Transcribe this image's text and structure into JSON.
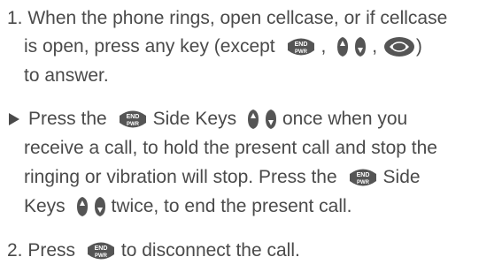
{
  "step1": {
    "number": "1.",
    "line1": "When the phone rings, open cellcase, or if cellcase",
    "line2_text": "is open, press any key (except",
    "line2_comma1": ",",
    "line2_comma2": ",",
    "line2_close": ")",
    "line3": "to answer."
  },
  "note": {
    "line1_a": "Press the",
    "line1_b": "Side Keys",
    "line1_c": "once when you",
    "line2": "receive a call, to hold the present call and stop the",
    "line3_a": "ringing or vibration will stop. Press the",
    "line3_b": "Side",
    "line4_a": "Keys",
    "line4_b": "twice, to end the present call."
  },
  "step2": {
    "number": "2.",
    "text_a": "Press",
    "text_b": "to disconnect the call."
  },
  "icons": {
    "end_key": "end-pwr-key-icon",
    "up_down": "up-down-side-keys-icon",
    "nav": "navigation-key-icon"
  },
  "end_key_label_top": "END",
  "end_key_label_bottom": "PWR",
  "colors": {
    "text": "#4a4a4a",
    "key": "#555555",
    "key_text": "#ffffff"
  }
}
